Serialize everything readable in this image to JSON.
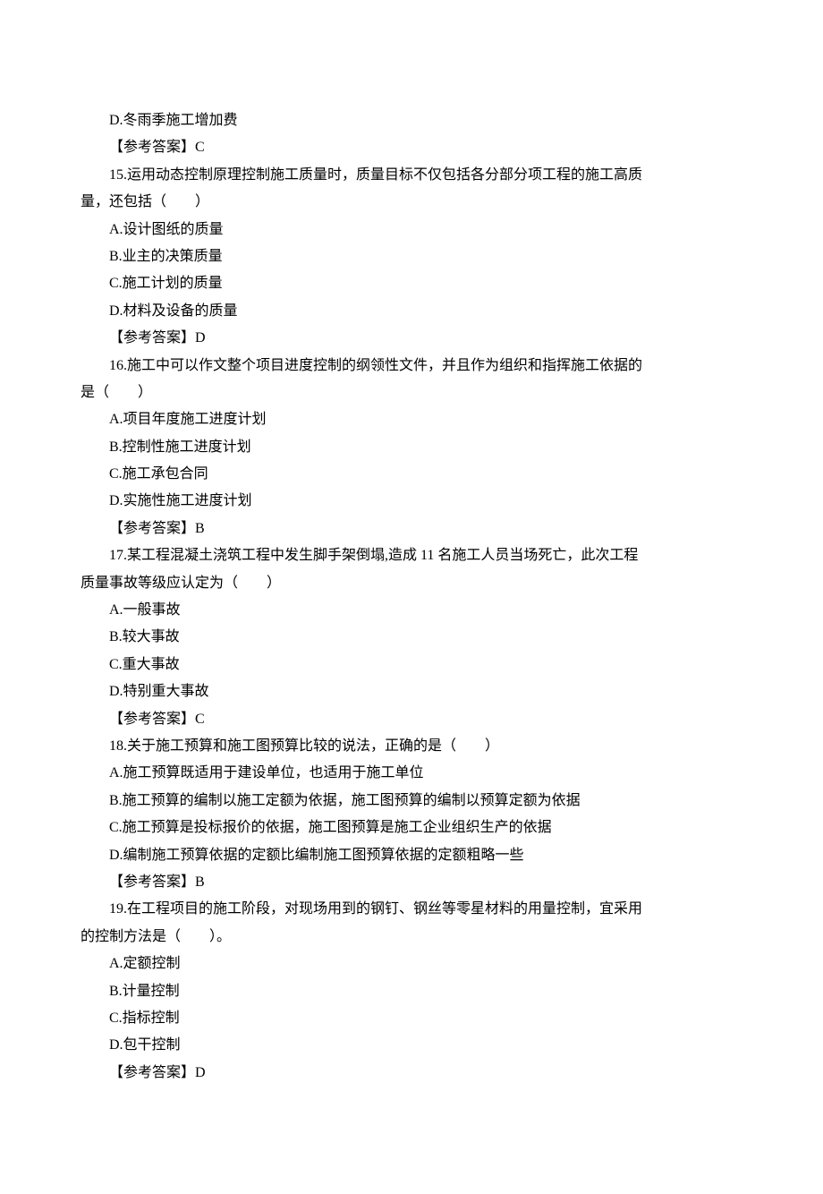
{
  "lines": [
    {
      "indent": 2,
      "text": "D.冬雨季施工增加费"
    },
    {
      "indent": 2,
      "text": "【参考答案】C"
    },
    {
      "indent": 2,
      "text": "15.运用动态控制原理控制施工质量时，质量目标不仅包括各分部分项工程的施工高质"
    },
    {
      "indent": 0,
      "text": "量，还包括（　　）"
    },
    {
      "indent": 2,
      "text": "A.设计图纸的质量"
    },
    {
      "indent": 2,
      "text": "B.业主的决策质量"
    },
    {
      "indent": 2,
      "text": "C.施工计划的质量"
    },
    {
      "indent": 2,
      "text": "D.材料及设备的质量"
    },
    {
      "indent": 2,
      "text": "【参考答案】D"
    },
    {
      "indent": 2,
      "text": "16.施工中可以作文整个项目进度控制的纲领性文件，并且作为组织和指挥施工依据的"
    },
    {
      "indent": 0,
      "text": "是（　　）"
    },
    {
      "indent": 2,
      "text": "A.项目年度施工进度计划"
    },
    {
      "indent": 2,
      "text": "B.控制性施工进度计划"
    },
    {
      "indent": 2,
      "text": "C.施工承包合同"
    },
    {
      "indent": 2,
      "text": "D.实施性施工进度计划"
    },
    {
      "indent": 2,
      "text": "【参考答案】B"
    },
    {
      "indent": 2,
      "text": "17.某工程混凝土浇筑工程中发生脚手架倒塌,造成 11 名施工人员当场死亡，此次工程"
    },
    {
      "indent": 0,
      "text": "质量事故等级应认定为（　　）"
    },
    {
      "indent": 2,
      "text": "A.一般事故"
    },
    {
      "indent": 2,
      "text": "B.较大事故"
    },
    {
      "indent": 2,
      "text": "C.重大事故"
    },
    {
      "indent": 2,
      "text": "D.特别重大事故"
    },
    {
      "indent": 2,
      "text": "【参考答案】C"
    },
    {
      "indent": 2,
      "text": "18.关于施工预算和施工图预算比较的说法，正确的是（　　）"
    },
    {
      "indent": 2,
      "text": "A.施工预算既适用于建设单位，也适用于施工单位"
    },
    {
      "indent": 2,
      "text": "B.施工预算的编制以施工定额为依据，施工图预算的编制以预算定额为依据"
    },
    {
      "indent": 2,
      "text": "C.施工预算是投标报价的依据，施工图预算是施工企业组织生产的依据"
    },
    {
      "indent": 2,
      "text": "D.编制施工预算依据的定额比编制施工图预算依据的定额粗略一些"
    },
    {
      "indent": 2,
      "text": "【参考答案】B"
    },
    {
      "indent": 2,
      "text": "19.在工程项目的施工阶段，对现场用到的钢钉、钢丝等零星材料的用量控制，宜采用"
    },
    {
      "indent": 0,
      "text": "的控制方法是（　　）。"
    },
    {
      "indent": 2,
      "text": "A.定额控制"
    },
    {
      "indent": 2,
      "text": "B.计量控制"
    },
    {
      "indent": 2,
      "text": "C.指标控制"
    },
    {
      "indent": 2,
      "text": "D.包干控制"
    },
    {
      "indent": 2,
      "text": "【参考答案】D"
    }
  ]
}
